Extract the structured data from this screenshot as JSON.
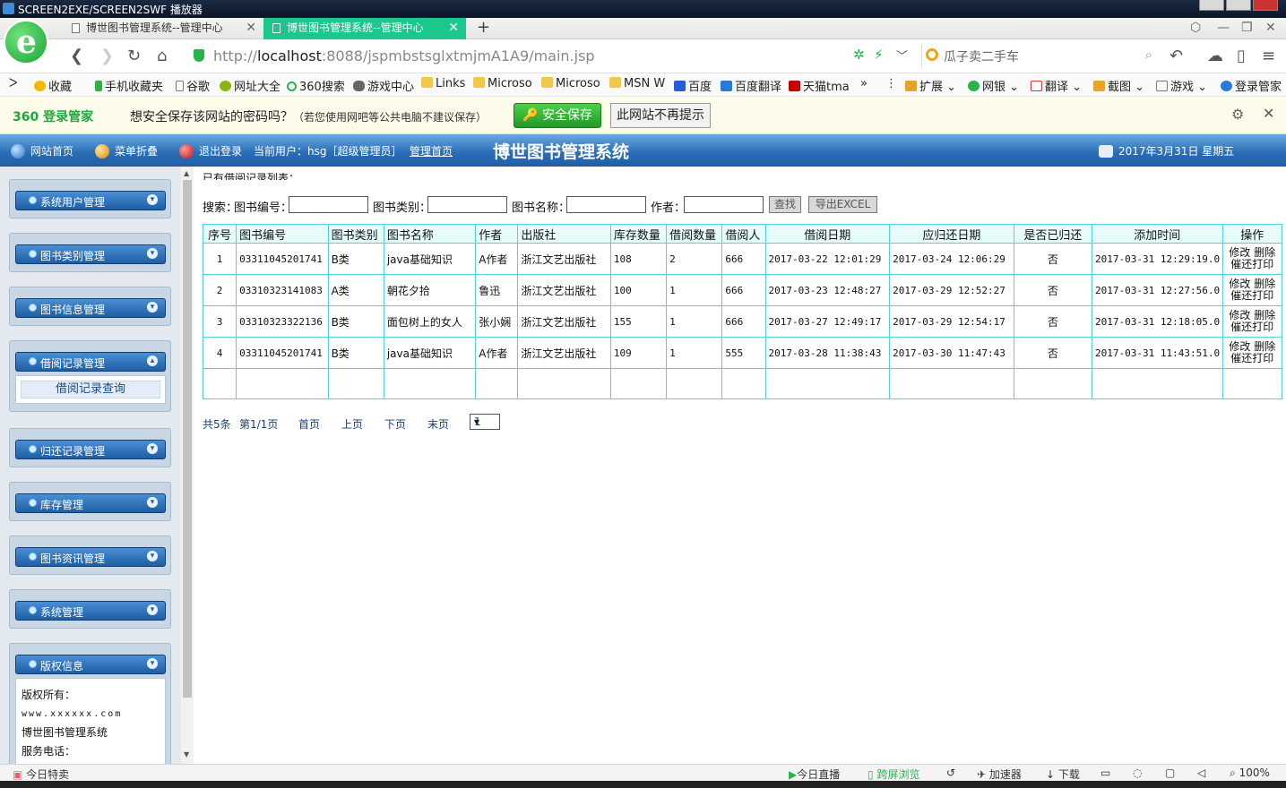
{
  "window": {
    "title": "SCREEN2EXE/SCREEN2SWF 播放器"
  },
  "tabs": [
    {
      "label": "博世图书管理系统--管理中心",
      "active": false
    },
    {
      "label": "博世图书管理系统--管理中心",
      "active": true
    }
  ],
  "address": {
    "host": "localhost",
    "prefix": "http://",
    "suffix": ":8088/jspmbstsglxtmjmA1A9/main.jsp"
  },
  "search_box": {
    "text": "瓜子卖二手车"
  },
  "bookmarks": [
    "收藏",
    "手机收藏夹",
    "谷歌",
    "网址大全",
    "360搜索",
    "游戏中心",
    "Links",
    "Microso",
    "Microso",
    "MSN W",
    "百度",
    "百度翻译",
    "天猫tma",
    "扩展",
    "网银",
    "翻译",
    "截图",
    "游戏",
    "登录管家"
  ],
  "password_bar": {
    "brand": "360 登录管家",
    "question": "想安全保存该网站的密码吗？",
    "note": "（若您使用网吧等公共电脑不建议保存）",
    "save_label": "安全保存",
    "never_label": "此网站不再提示"
  },
  "header": {
    "home": "网站首页",
    "fold_menu": "菜单折叠",
    "logout": "退出登录",
    "current_user": "当前用户：hsg［超级管理员］",
    "admin_home": "管理首页",
    "title": "博世图书管理系统",
    "date": "2017年3月31日 星期五"
  },
  "sidebar": {
    "menus": [
      "系统用户管理",
      "图书类别管理",
      "图书信息管理",
      "借阅记录管理",
      "归还记录管理",
      "库存管理",
      "图书资讯管理",
      "系统管理",
      "版权信息"
    ],
    "submenu_item": "借阅记录查询",
    "copyright": {
      "owner_label": "版权所有：",
      "site": "www.xxxxxx.com",
      "name": "博世图书管理系统",
      "phone_label": "服务电话："
    }
  },
  "main": {
    "list_title": "已有借阅记录列表：",
    "search": {
      "prefix": "搜索：",
      "book_no_label": "图书编号：",
      "category_label": "图书类别：",
      "book_name_label": "图书名称：",
      "author_label": "作者：",
      "search_button": "查找",
      "export_button": "导出EXCEL"
    },
    "columns": [
      "序号",
      "图书编号",
      "图书类别",
      "图书名称",
      "作者",
      "出版社",
      "库存数量",
      "借阅数量",
      "借阅人",
      "借阅日期",
      "应归还日期",
      "是否已归还",
      "添加时间",
      "操作"
    ],
    "rows": [
      [
        "1",
        "03311045201741",
        "B类",
        "java基础知识",
        "A作者",
        "浙江文艺出版社",
        "108",
        "2",
        "666",
        "2017-03-22 12:01:29",
        "2017-03-24 12:06:29",
        "否",
        "2017-03-31 12:29:19.0"
      ],
      [
        "2",
        "03310323141083",
        "A类",
        "朝花夕拾",
        "鲁迅",
        "浙江文艺出版社",
        "100",
        "1",
        "666",
        "2017-03-23 12:48:27",
        "2017-03-29 12:52:27",
        "否",
        "2017-03-31 12:27:56.0"
      ],
      [
        "3",
        "03310323322136",
        "B类",
        "面包树上的女人",
        "张小娴",
        "浙江文艺出版社",
        "155",
        "1",
        "666",
        "2017-03-27 12:49:17",
        "2017-03-29 12:54:17",
        "否",
        "2017-03-31 12:18:05.0"
      ],
      [
        "4",
        "03311045201741",
        "B类",
        "java基础知识",
        "A作者",
        "浙江文艺出版社",
        "109",
        "1",
        "555",
        "2017-03-28 11:38:43",
        "2017-03-30 11:47:43",
        "否",
        "2017-03-31 11:43:51.0"
      ]
    ],
    "ops": {
      "edit": "修改",
      "delete": "删除",
      "remind": "催还打印"
    },
    "pager": {
      "total": "共5条",
      "page": "第1/1页",
      "first": "首页",
      "prev": "上页",
      "next": "下页",
      "last": "末页",
      "selected": "1"
    }
  },
  "statusbar": {
    "left": "今日特卖",
    "live": "今日直播",
    "cross": "跨屏浏览",
    "accel": "加速器",
    "download": "下载",
    "zoom": "100%"
  }
}
